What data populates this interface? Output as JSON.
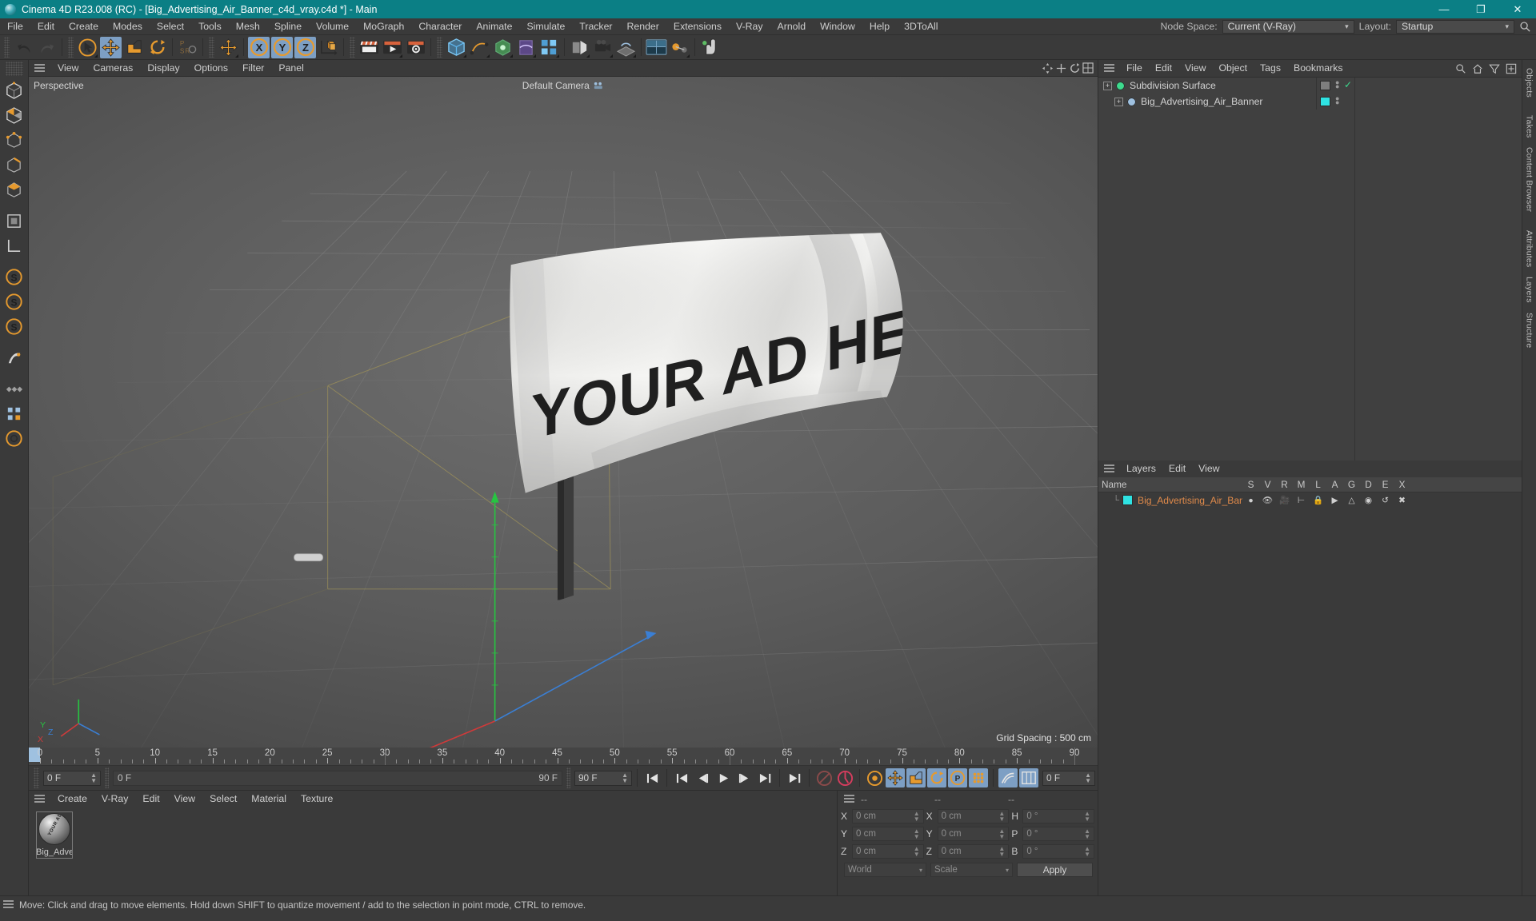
{
  "titlebar": {
    "text": "Cinema 4D R23.008 (RC) - [Big_Advertising_Air_Banner_c4d_vray.c4d *] - Main",
    "minimize": "—",
    "maximize": "❐",
    "close": "✕",
    "accent": "#0b7f85"
  },
  "menubar": {
    "items": [
      "File",
      "Edit",
      "Create",
      "Modes",
      "Select",
      "Tools",
      "Mesh",
      "Spline",
      "Volume",
      "MoGraph",
      "Character",
      "Animate",
      "Simulate",
      "Tracker",
      "Render",
      "Extensions",
      "V-Ray",
      "Arnold",
      "Window",
      "Help",
      "3DToAll"
    ],
    "node_space_label": "Node Space:",
    "node_space_value": "Current (V-Ray)",
    "layout_label": "Layout:",
    "layout_value": "Startup"
  },
  "viewport": {
    "menu": [
      "View",
      "Cameras",
      "Display",
      "Options",
      "Filter",
      "Panel"
    ],
    "projection_label": "Perspective",
    "camera_label": "Default Camera",
    "grid_spacing": "Grid Spacing : 500 cm",
    "banner_text": "YOUR AD HERE",
    "axis_labels": {
      "x": "X",
      "y": "Y",
      "z": "Z"
    }
  },
  "timeline": {
    "ticks": [
      0,
      5,
      10,
      15,
      20,
      25,
      30,
      35,
      40,
      45,
      50,
      55,
      60,
      65,
      70,
      75,
      80,
      85,
      90
    ],
    "current_frame": "0 F",
    "current_frame_flat": "0 F",
    "end_frame": "90 F",
    "end_frame_field": "90 F",
    "preview_end": "90 F",
    "right_frame": "0 F"
  },
  "material_manager": {
    "menu": [
      "Create",
      "V-Ray",
      "Edit",
      "View",
      "Select",
      "Material",
      "Texture"
    ],
    "materials": [
      {
        "name": "Big_Adve",
        "preview_text": "YOUR AD HERE"
      }
    ]
  },
  "coordinates": {
    "header": [
      "--",
      "--",
      "--"
    ],
    "rows": [
      {
        "pos_label": "X",
        "pos_value": "0 cm",
        "size_label": "X",
        "size_value": "0 cm",
        "rot_label": "H",
        "rot_value": "0 °"
      },
      {
        "pos_label": "Y",
        "pos_value": "0 cm",
        "size_label": "Y",
        "size_value": "0 cm",
        "rot_label": "P",
        "rot_value": "0 °"
      },
      {
        "pos_label": "Z",
        "pos_value": "0 cm",
        "size_label": "Z",
        "size_value": "0 cm",
        "rot_label": "B",
        "rot_value": "0 °"
      }
    ],
    "system": "World",
    "mode": "Scale",
    "apply": "Apply"
  },
  "object_manager": {
    "menu": [
      "File",
      "Edit",
      "View",
      "Object",
      "Tags",
      "Bookmarks"
    ],
    "items": [
      {
        "name": "Subdivision Surface",
        "depth": 0,
        "color": "#3ddb8e",
        "tag_color": "#7e7e7e"
      },
      {
        "name": "Big_Advertising_Air_Banner",
        "depth": 1,
        "color": "#9fc1e0",
        "tag_color": "#2fe3e3"
      }
    ]
  },
  "layer_manager": {
    "menu": [
      "Layers",
      "Edit",
      "View"
    ],
    "name_header": "Name",
    "columns": [
      "S",
      "V",
      "R",
      "M",
      "L",
      "A",
      "G",
      "D",
      "E",
      "X"
    ],
    "rows": [
      {
        "name": "Big_Advertising_Air_Banner",
        "swatch": "#2fe3e3",
        "text_color": "#e08a4a"
      }
    ]
  },
  "edge_tabs": [
    "Objects",
    "Takes",
    "Content Browser",
    "Attributes",
    "Layers",
    "Structure"
  ],
  "status": {
    "text": "Move: Click and drag to move elements. Hold down SHIFT to quantize movement / add to the selection in point mode, CTRL to remove."
  }
}
